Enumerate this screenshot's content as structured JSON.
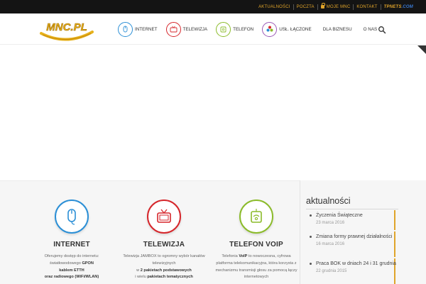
{
  "topbar": {
    "links": [
      "AKTUALNOŚCI",
      "POCZTA",
      "MOJE MNC",
      "KONTAKT"
    ],
    "partner": {
      "main": "TPnets",
      "suffix": ".com"
    }
  },
  "header": {
    "logo_text": "MNC.PL",
    "nav": [
      {
        "label": "INTERNET",
        "icon": "mouse-icon",
        "color": "#2b8fd6"
      },
      {
        "label": "TELEWIZJA",
        "icon": "tv-icon",
        "color": "#d6262b"
      },
      {
        "label": "TELEFON",
        "icon": "phone-icon",
        "color": "#8bbb2a"
      },
      {
        "label": "USŁ. ŁĄCZONE",
        "icon": "bundle-icon",
        "color": "#9b59b6"
      },
      {
        "label": "DLA BIZNESU",
        "icon": "",
        "color": ""
      },
      {
        "label": "O NAS",
        "icon": "",
        "color": ""
      }
    ]
  },
  "services": [
    {
      "title": "INTERNET",
      "color": "#2b8fd6",
      "icon": "mouse-icon",
      "desc_html": "Oferujemy dostęp do internetu: światłowodowego <b>GPON</b><br><b>kablem ETTH</b><br><b>oraz radiowego (WiFi/WLAN)</b>"
    },
    {
      "title": "TELEWIZJA",
      "color": "#d6262b",
      "icon": "tv-icon",
      "desc_html": "Telewizja JAMBOX to ogromny wybór kanałów telewizyjnych<br>w <b>2 pakietach podstawowych</b><br>i wielu <b>pakietach tematycznych</b>"
    },
    {
      "title": "TELEFON VoIP",
      "color": "#8bbb2a",
      "icon": "phone-icon",
      "desc_html": "Telefonia <b>VoIP</b> to nowoczesna, cyfrowa platforma telekomunikacyjna, która korzysta z mechanizmu transmisji głosu za pomocą łączy internetowych"
    }
  ],
  "news": {
    "title": "aktualności",
    "items": [
      {
        "title": "Życzenia Świąteczne",
        "date": "23 marca 2016"
      },
      {
        "title": "Zmiana formy prawnej działalności",
        "date": "16 marca 2016"
      },
      {
        "title": "Praca BOK w dniach 24 i 31 grudnia",
        "date": "22 grudnia 2015"
      }
    ]
  },
  "colors": {
    "accent": "#e0a42a",
    "topbar": "#141414"
  }
}
